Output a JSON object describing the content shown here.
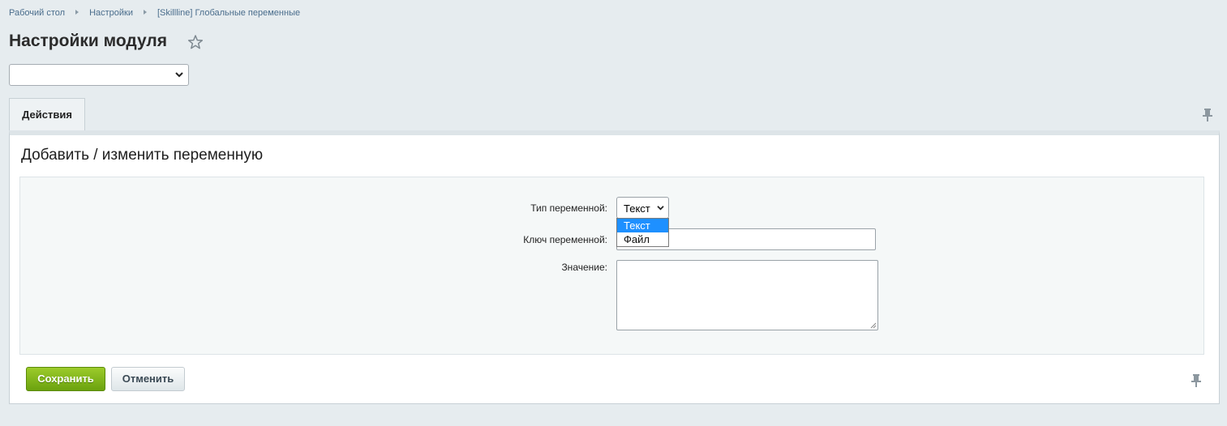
{
  "breadcrumb": [
    "Рабочий стол",
    "Настройки",
    "[Skillline] Глобальные переменные"
  ],
  "page": {
    "title": "Настройки модуля"
  },
  "module_select": {
    "value": ""
  },
  "tabs": [
    {
      "label": "Действия"
    }
  ],
  "form": {
    "section_title": "Добавить / изменить переменную",
    "type_label": "Тип переменной:",
    "type_value": "Текст",
    "type_options": [
      "Текст",
      "Файл"
    ],
    "key_label": "Ключ переменной:",
    "key_value": "",
    "value_label": "Значение:",
    "value_value": ""
  },
  "buttons": {
    "save": "Сохранить",
    "cancel": "Отменить"
  },
  "colors": {
    "accent_green": "#7ab317",
    "link": "#4a6d8c",
    "dropdown_highlight": "#1e90ff"
  }
}
